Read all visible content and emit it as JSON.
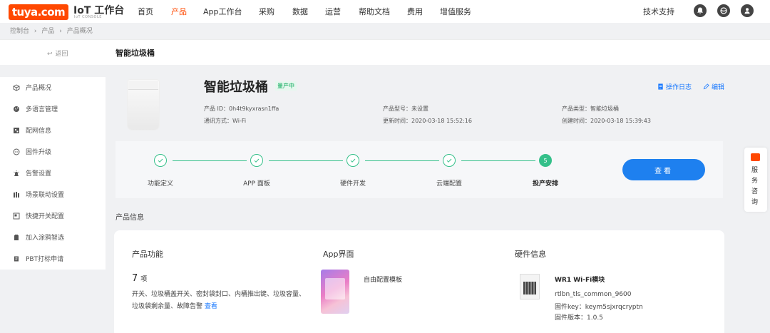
{
  "brand": {
    "logo_text": "tuya.com",
    "console_title": "IoT 工作台",
    "console_sub": "IoT CONSOLE",
    "accent": "#ff4800"
  },
  "nav": {
    "items": [
      {
        "label": "首页",
        "active": false
      },
      {
        "label": "产品",
        "active": true
      },
      {
        "label": "App工作台",
        "active": false
      },
      {
        "label": "采购",
        "active": false
      },
      {
        "label": "数据",
        "active": false
      },
      {
        "label": "运营",
        "active": false
      },
      {
        "label": "帮助文档",
        "active": false
      },
      {
        "label": "费用",
        "active": false
      },
      {
        "label": "增值服务",
        "active": false
      }
    ],
    "support": "技术支持",
    "right_icons": [
      "bell-icon",
      "globe-icon",
      "user-icon"
    ]
  },
  "breadcrumb": [
    "控制台",
    "›",
    "产品",
    "›",
    "产品概况"
  ],
  "backbar": {
    "back_label": "返回",
    "page_name": "智能垃圾桶"
  },
  "sidebar": {
    "items": [
      {
        "label": "产品概况",
        "icon": "cube-icon"
      },
      {
        "label": "多语言管理",
        "icon": "globe-icon"
      },
      {
        "label": "配网信息",
        "icon": "network-config-icon"
      },
      {
        "label": "固件升级",
        "icon": "firmware-icon"
      },
      {
        "label": "告警设置",
        "icon": "alarm-icon"
      },
      {
        "label": "场景联动设置",
        "icon": "scene-icon"
      },
      {
        "label": "快捷开关配置",
        "icon": "switch-icon"
      },
      {
        "label": "加入涂鸦智选",
        "icon": "bag-icon"
      },
      {
        "label": "PBT打标申请",
        "icon": "tag-icon"
      }
    ]
  },
  "product": {
    "name": "智能垃圾桶",
    "status": "量产中",
    "log_label": "操作日志",
    "edit_label": "编辑",
    "meta": {
      "pid": "产品 ID：0h4t9kyxrasn1ffa",
      "protocol": "通讯方式：Wi-Fi",
      "model": "产品型号：未设置",
      "updated": "更新时间：2020-03-18 15:52:16",
      "type": "产品类型：智能垃圾桶",
      "created": "创建时间：2020-03-18 15:39:43"
    }
  },
  "steps": {
    "items": [
      {
        "label": "功能定义",
        "done": true
      },
      {
        "label": "APP 面板",
        "done": true
      },
      {
        "label": "硬件开发",
        "done": true
      },
      {
        "label": "云端配置",
        "done": true
      },
      {
        "label": "投产安排",
        "done": false,
        "number": "5"
      }
    ],
    "view_button": "查看",
    "color_done": "#35c08a",
    "button_color": "#1e80ef"
  },
  "product_info": {
    "section_title": "产品信息",
    "function": {
      "heading": "产品功能",
      "count": "7",
      "unit": "项",
      "description": "开关、垃圾桶盖开关、密封袋封口、内桶推出键、垃圾容量、垃圾袋剩余量、故障告警",
      "link": "查看"
    },
    "app": {
      "heading": "App界面",
      "template": "自由配置模板"
    },
    "hardware": {
      "heading": "硬件信息",
      "module": "WR1 Wi-Fi模块",
      "firmware_name": "rtlbn_tls_common_9600",
      "firmware_key": "固件key：keym5sjxrqcryptn",
      "firmware_version": "固件版本：1.0.5"
    }
  },
  "consult": {
    "label": "服务咨询"
  }
}
